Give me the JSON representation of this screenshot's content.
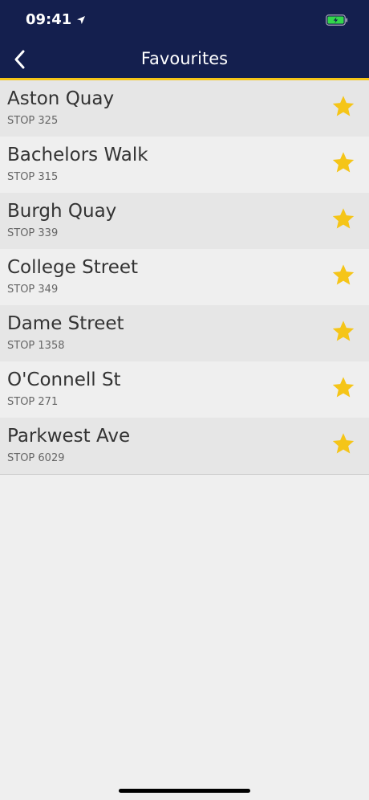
{
  "status_bar": {
    "time": "09:41"
  },
  "header": {
    "title": "Favourites"
  },
  "colors": {
    "header_bg": "#141f4e",
    "accent": "#f5c518",
    "star": "#f5c518",
    "battery_fill": "#32d74b"
  },
  "favourites": [
    {
      "name": "Aston Quay",
      "stop": "STOP 325"
    },
    {
      "name": "Bachelors Walk",
      "stop": "STOP 315"
    },
    {
      "name": "Burgh Quay",
      "stop": "STOP 339"
    },
    {
      "name": "College Street",
      "stop": "STOP 349"
    },
    {
      "name": "Dame Street",
      "stop": "STOP 1358"
    },
    {
      "name": "O'Connell St",
      "stop": "STOP 271"
    },
    {
      "name": "Parkwest Ave",
      "stop": "STOP 6029"
    }
  ]
}
